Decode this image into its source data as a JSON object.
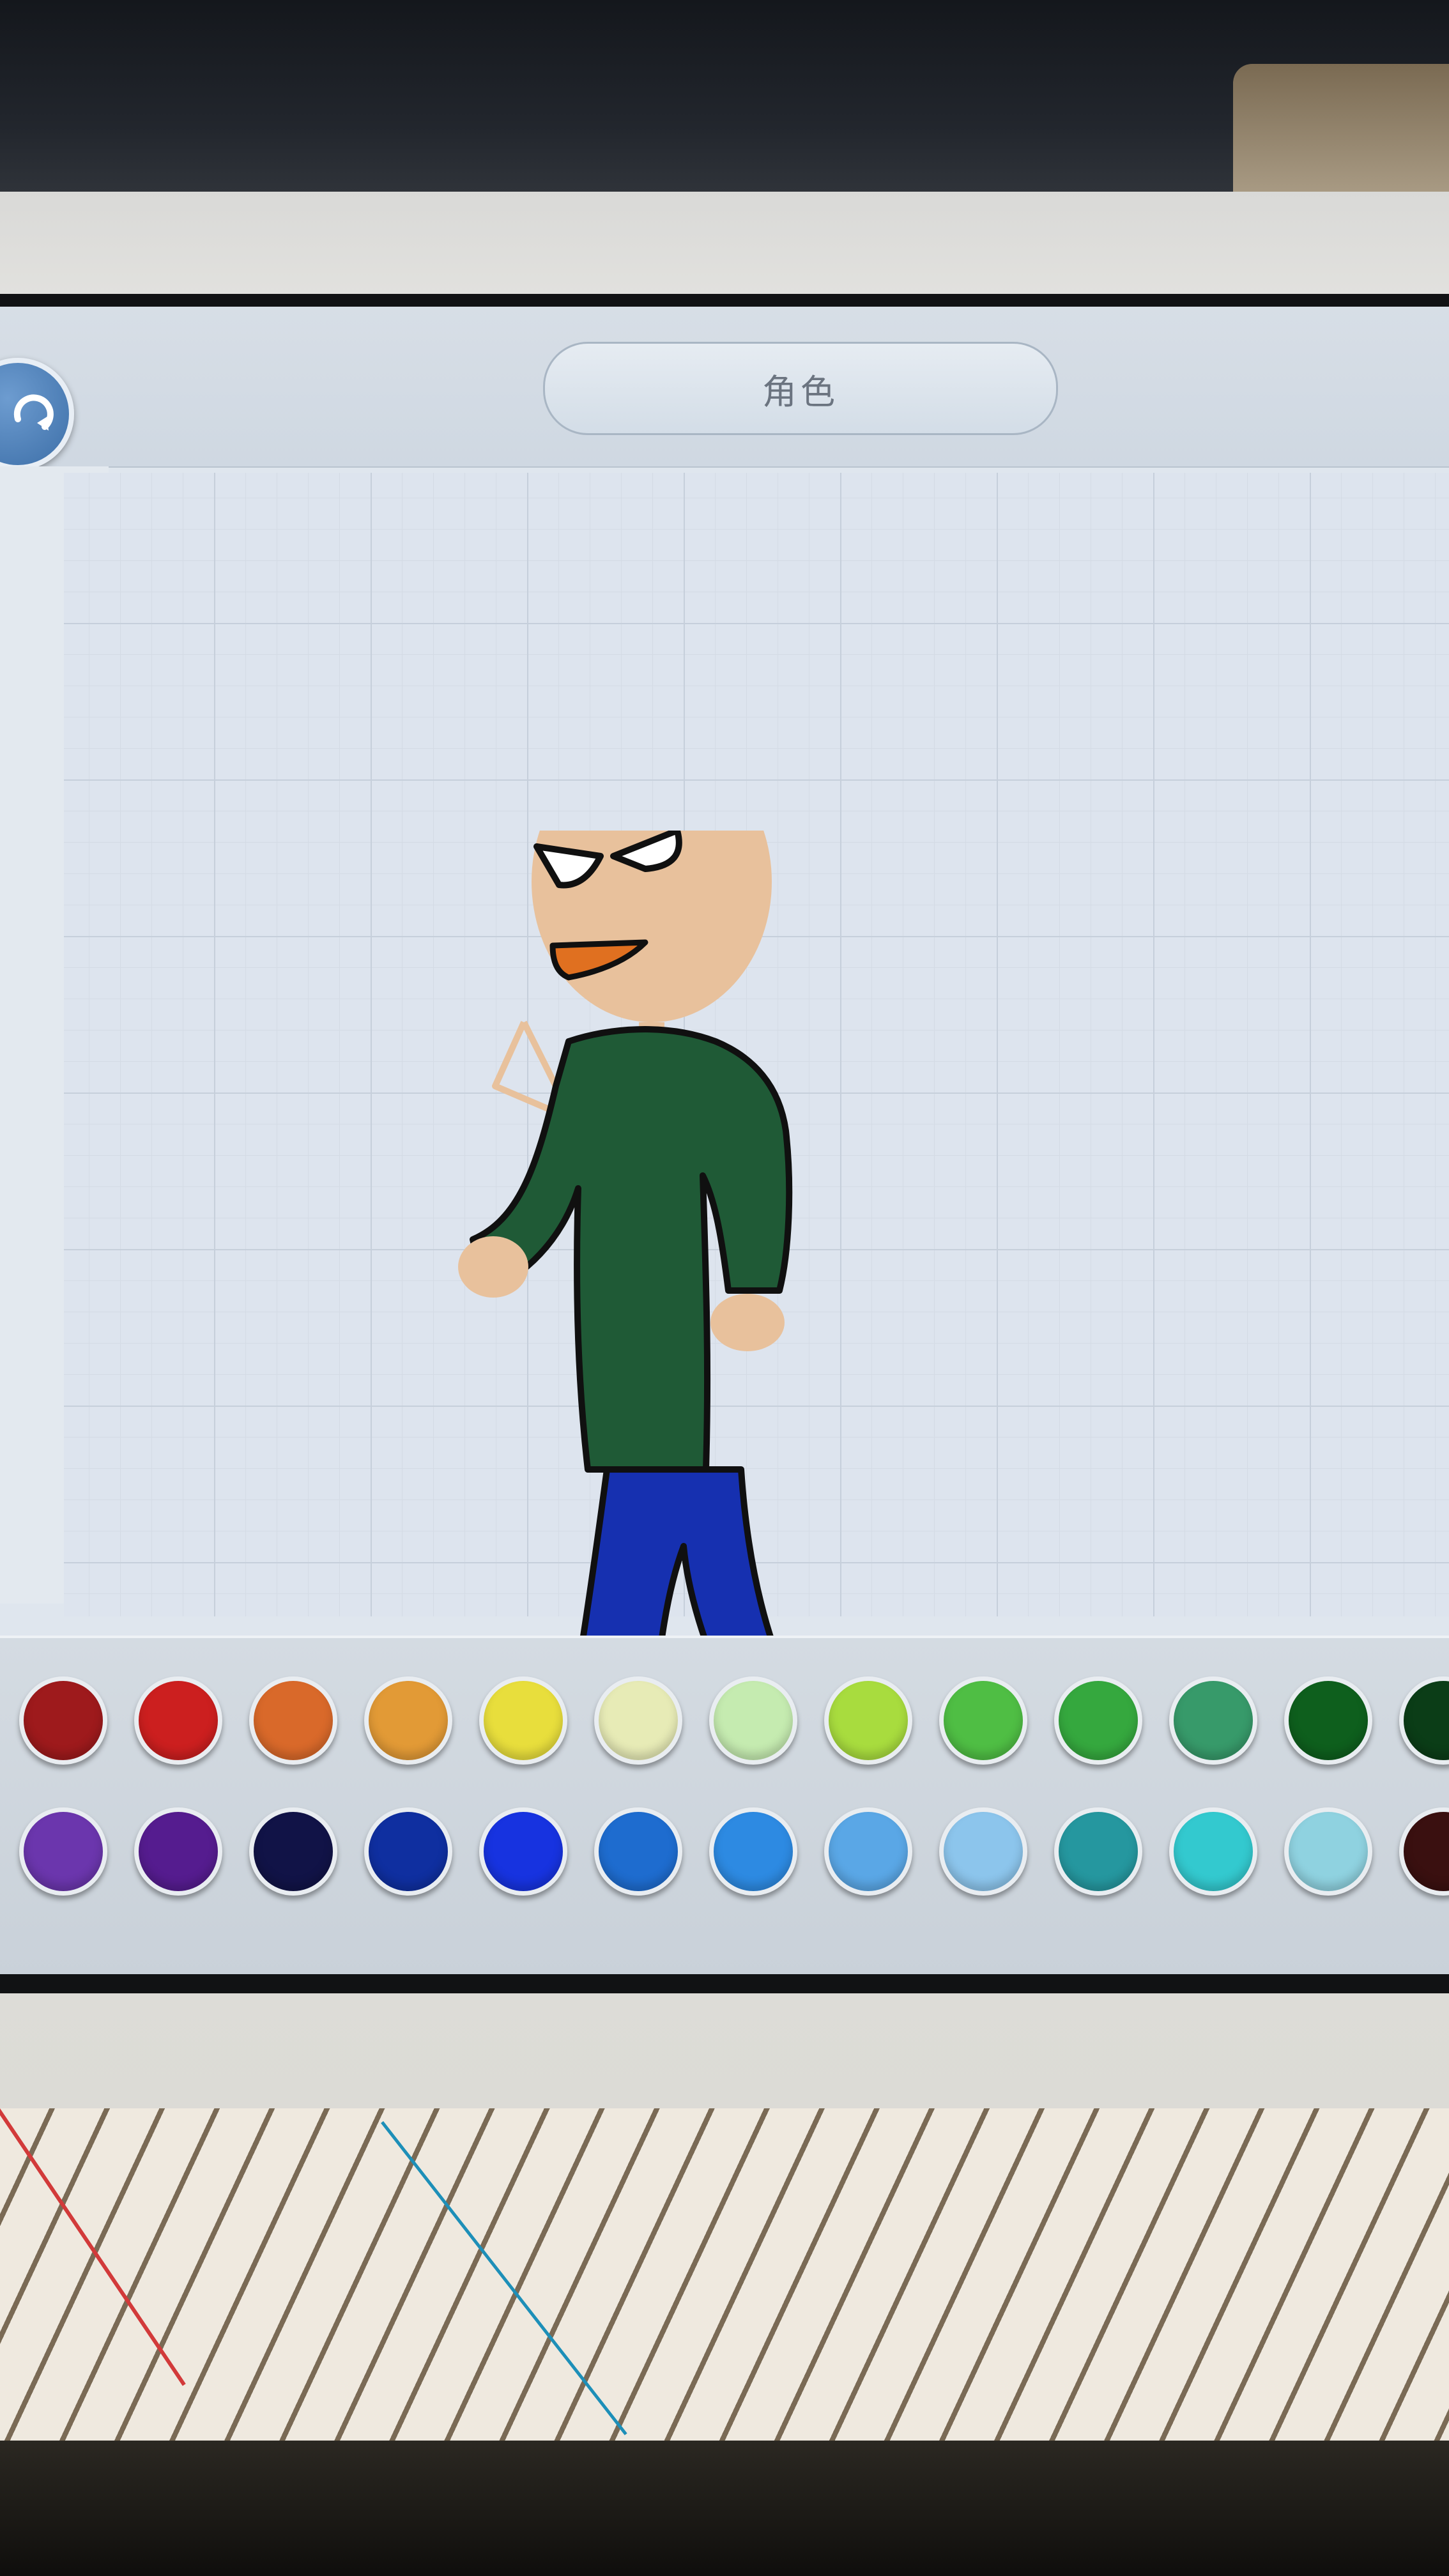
{
  "header": {
    "title": "角色"
  },
  "back_button": {
    "icon": "refresh-arrow-icon"
  },
  "palette": {
    "row1": [
      "#9e1a1c",
      "#cc1f1f",
      "#d9692a",
      "#e29a36",
      "#e8de3c",
      "#e7ebb6",
      "#c5ebb0",
      "#a8dc3e",
      "#4fbe44",
      "#35a83e",
      "#379a6a",
      "#0e5f1d",
      "#0b3d17"
    ],
    "row2": [
      "#6b36ad",
      "#551c8f",
      "#111347",
      "#0f2fa0",
      "#1733e0",
      "#1e6ccf",
      "#2d8ae2",
      "#5aa7e6",
      "#8cc5ec",
      "#25979f",
      "#33c9cf",
      "#8fd2e0",
      "#3a1010"
    ]
  },
  "character": {
    "hat_color": "#4a2e28",
    "skin_color": "#e8c19c",
    "shirt_color": "#1f5a36",
    "pants_color": "#1630b0",
    "shoe_color": "#3e1c15",
    "mouth_color": "#e07020"
  }
}
